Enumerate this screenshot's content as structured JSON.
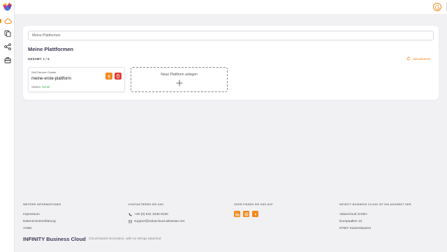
{
  "app": {
    "brand": "INFINITY Business Cloud",
    "tagline": "Cloud-based innovation, with no strings attached",
    "accent": "#f08a1c"
  },
  "sidebar": {
    "items": [
      {
        "icon": "cloud-icon",
        "active": true
      },
      {
        "icon": "copy-icon"
      },
      {
        "icon": "share-icon"
      },
      {
        "icon": "briefcase-icon"
      }
    ]
  },
  "main": {
    "breadcrumb": "Meine Plattformen",
    "title": "Meine Plattformen",
    "total": "GESAMT: 1 / 5",
    "refresh_label": "Aktualisieren",
    "platforms": [
      {
        "type": "Self-Service Cluster",
        "name": "meine-erste-plattform",
        "status_label": "Status:",
        "status_value": "bereit"
      }
    ],
    "add_platform_label": "Neue Plattform anlegen"
  },
  "footer": {
    "info": {
      "heading": "WEITERE INFORMATIONEN",
      "links": [
        "Impressum",
        "Datenschutzerklärung",
        "AGBs"
      ]
    },
    "contact": {
      "heading": "KONTAKTIEREN SIE UNS",
      "phone": "+49 (0) 631 3435 8150",
      "email": "support@valuecloud.atlassian.net"
    },
    "social": {
      "heading": "ODER FINDEN SIE UNS AUF",
      "icons": [
        "linkedin-icon",
        "blogger-icon",
        "youtube-icon"
      ]
    },
    "company": {
      "heading": "INFINITY BUSINESS CLOUD IST EIN ANGEBOT DER",
      "name": "ValueCloud GmbH",
      "street": "Europaallee 10",
      "city": "67657 Kaiserslautern"
    }
  }
}
